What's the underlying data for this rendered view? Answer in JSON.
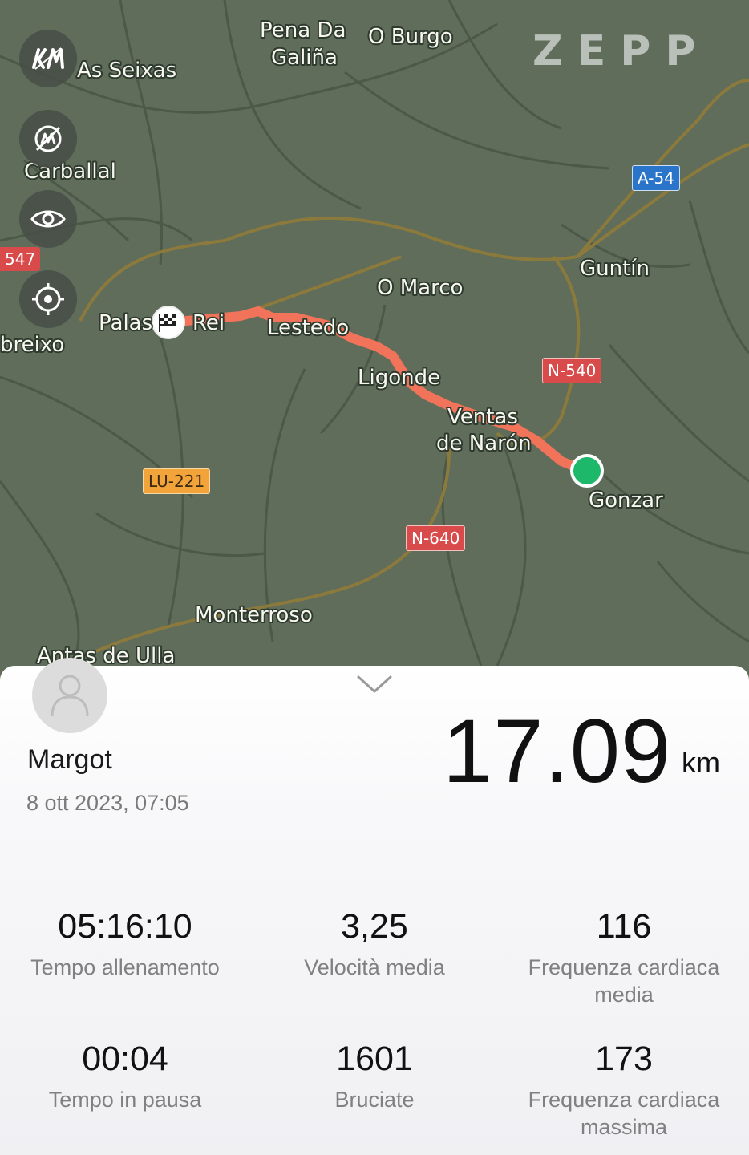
{
  "brand": "ZEPP",
  "map": {
    "places": [
      "As Seixas",
      "Pena Da",
      "Galiña",
      "O Burgo",
      "Carballal",
      "O Marco",
      "Guntín",
      "Palas",
      "Rei",
      "Lestedo",
      "Ligonde",
      "Ventas",
      "de Narón",
      "Gonzar",
      "Monterroso",
      "Antas de Ulla",
      "breixo"
    ],
    "roads": [
      "A-54",
      "N-540",
      "LU-221",
      "N-640",
      "547"
    ],
    "buttons": [
      "km-markers-icon",
      "hide-markers-icon",
      "eye-icon",
      "locate-icon"
    ]
  },
  "activity": {
    "user": "Margot",
    "date": "8 ott 2023, 07:05",
    "distance": "17.09",
    "distance_unit": "km"
  },
  "stats": [
    {
      "value": "05:16:10",
      "label": "Tempo allenamento"
    },
    {
      "value": "3,25",
      "label": "Velocità media"
    },
    {
      "value": "116",
      "label": "Frequenza cardiaca media"
    },
    {
      "value": "00:04",
      "label": "Tempo in pausa"
    },
    {
      "value": "1601",
      "label": "Bruciate"
    },
    {
      "value": "173",
      "label": "Frequenza cardiaca massima"
    }
  ],
  "colors": {
    "route": "#f0735a",
    "start": "#1db86a",
    "map_bg": "#5f6d5a",
    "road_red": "#d94a4a",
    "road_orange": "#f2a33a",
    "road_blue": "#2a74c9"
  }
}
